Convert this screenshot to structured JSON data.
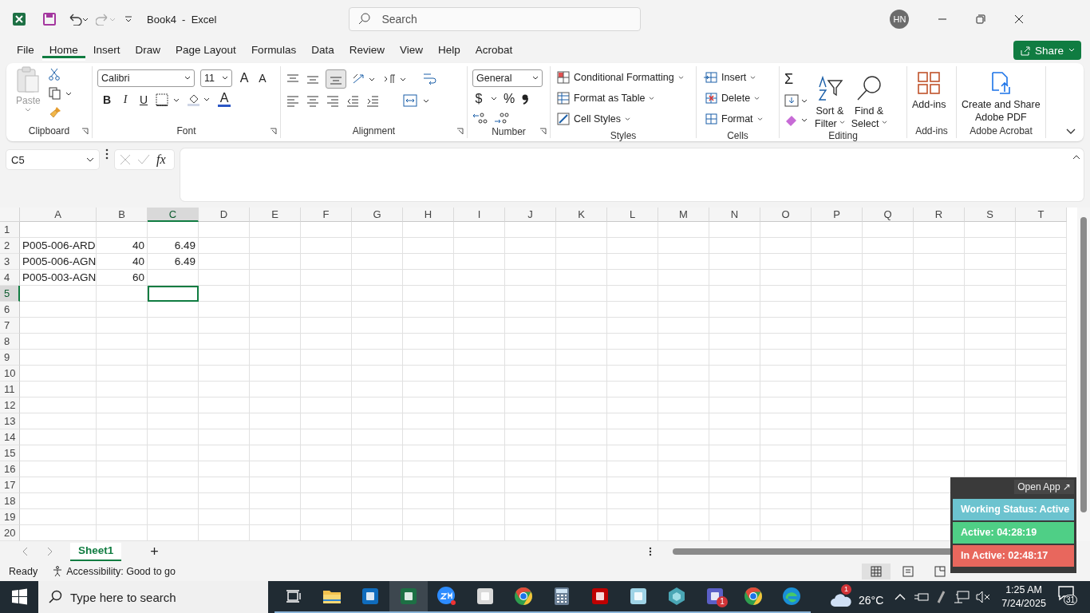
{
  "title_bar": {
    "title": "Book4  -  Excel",
    "search": {
      "placeholder": "Search"
    },
    "avatar": "HN"
  },
  "tabs": [
    {
      "label": "File",
      "selected": false
    },
    {
      "label": "Home",
      "selected": true
    },
    {
      "label": "Insert",
      "selected": false
    },
    {
      "label": "Draw",
      "selected": false
    },
    {
      "label": "Page Layout",
      "selected": false
    },
    {
      "label": "Formulas",
      "selected": false
    },
    {
      "label": "Data",
      "selected": false
    },
    {
      "label": "Review",
      "selected": false
    },
    {
      "label": "View",
      "selected": false
    },
    {
      "label": "Help",
      "selected": false
    },
    {
      "label": "Acrobat",
      "selected": false
    }
  ],
  "share_button": "Share",
  "ribbon": {
    "clipboard": {
      "paste": "Paste",
      "label": "Clipboard"
    },
    "font": {
      "name": "Calibri",
      "size": "11",
      "grow": "A",
      "shrink": "A",
      "bold": "B",
      "italic": "I",
      "underline": "U",
      "color_letter": "A",
      "label": "Font"
    },
    "alignment": {
      "label": "Alignment"
    },
    "number": {
      "format": "General",
      "currency": "$",
      "percent": "%",
      "label": "Number"
    },
    "styles": {
      "items": [
        "Conditional Formatting",
        "Format as Table",
        "Cell Styles"
      ],
      "label": "Styles"
    },
    "cells": {
      "items": [
        "Insert",
        "Delete",
        "Format"
      ],
      "label": "Cells"
    },
    "editing": {
      "sum": "Σ",
      "sort": [
        "Sort &",
        "Filter"
      ],
      "find": [
        "Find &",
        "Select"
      ],
      "label": "Editing"
    },
    "addins": {
      "button": "Add-ins",
      "label": "Add-ins"
    },
    "acrobat": {
      "button": [
        "Create and Share",
        "Adobe PDF"
      ],
      "label": "Adobe Acrobat"
    }
  },
  "formula_bar": {
    "name_box": "C5",
    "function_label": "fx"
  },
  "sheet": {
    "columns": [
      {
        "label": "A",
        "selected": false
      },
      {
        "label": "B",
        "selected": false
      },
      {
        "label": "C",
        "selected": true
      },
      {
        "label": "D",
        "selected": false
      },
      {
        "label": "E",
        "selected": false
      },
      {
        "label": "F",
        "selected": false
      },
      {
        "label": "G",
        "selected": false
      },
      {
        "label": "H",
        "selected": false
      },
      {
        "label": "I",
        "selected": false
      },
      {
        "label": "J",
        "selected": false
      },
      {
        "label": "K",
        "selected": false
      },
      {
        "label": "L",
        "selected": false
      },
      {
        "label": "M",
        "selected": false
      },
      {
        "label": "N",
        "selected": false
      },
      {
        "label": "O",
        "selected": false
      },
      {
        "label": "P",
        "selected": false
      },
      {
        "label": "Q",
        "selected": false
      },
      {
        "label": "R",
        "selected": false
      },
      {
        "label": "S",
        "selected": false
      },
      {
        "label": "T",
        "selected": false
      }
    ],
    "rows": [
      {
        "number": "1",
        "selected": false,
        "cells": {}
      },
      {
        "number": "2",
        "selected": false,
        "cells": {
          "A": "P005-006-ARD",
          "B": "40",
          "C": "6.49"
        }
      },
      {
        "number": "3",
        "selected": false,
        "cells": {
          "A": "P005-006-AGN",
          "B": "40",
          "C": "6.49"
        }
      },
      {
        "number": "4",
        "selected": false,
        "cells": {
          "A": "P005-003-AGN",
          "B": "60"
        }
      },
      {
        "number": "5",
        "selected": true,
        "cells": {}
      },
      {
        "number": "6",
        "selected": false,
        "cells": {}
      },
      {
        "number": "7",
        "selected": false,
        "cells": {}
      },
      {
        "number": "8",
        "selected": false,
        "cells": {}
      },
      {
        "number": "9",
        "selected": false,
        "cells": {}
      },
      {
        "number": "10",
        "selected": false,
        "cells": {}
      },
      {
        "number": "11",
        "selected": false,
        "cells": {}
      },
      {
        "number": "12",
        "selected": false,
        "cells": {}
      },
      {
        "number": "13",
        "selected": false,
        "cells": {}
      },
      {
        "number": "14",
        "selected": false,
        "cells": {}
      },
      {
        "number": "15",
        "selected": false,
        "cells": {}
      },
      {
        "number": "16",
        "selected": false,
        "cells": {}
      },
      {
        "number": "17",
        "selected": false,
        "cells": {}
      },
      {
        "number": "18",
        "selected": false,
        "cells": {}
      },
      {
        "number": "19",
        "selected": false,
        "cells": {}
      },
      {
        "number": "20",
        "selected": false,
        "cells": {}
      }
    ]
  },
  "sheet_tabs": [
    {
      "label": "Sheet1",
      "selected": true
    }
  ],
  "add_sheet": "+",
  "status_bar": {
    "mode": "Ready",
    "accessibility": "Accessibility: Good to go"
  },
  "tracker": {
    "open_app": "Open App ↗",
    "rows": [
      {
        "text": "Working Status: Active",
        "color": "#6cc3cf"
      },
      {
        "text": "Active: 04:28:19",
        "color": "#4fcf86"
      },
      {
        "text": "In Active: 02:48:17",
        "color": "#e8675d"
      }
    ]
  },
  "taskbar": {
    "search": {
      "placeholder": "Type here to search"
    },
    "apps": [
      {
        "kind": "taskview",
        "selected": false
      },
      {
        "kind": "folder",
        "selected": false
      },
      {
        "kind": "outlook",
        "selected": false
      },
      {
        "kind": "excel",
        "selected": true
      },
      {
        "kind": "zoom",
        "selected": false
      },
      {
        "kind": "satellite",
        "selected": false
      },
      {
        "kind": "chrome",
        "selected": false
      },
      {
        "kind": "calculator",
        "selected": false
      },
      {
        "kind": "filezilla",
        "selected": false
      },
      {
        "kind": "notepad",
        "selected": false
      },
      {
        "kind": "hexagon",
        "selected": false
      },
      {
        "kind": "teams",
        "selected": false,
        "badge": "1"
      },
      {
        "kind": "chrome",
        "selected": false
      },
      {
        "kind": "edge",
        "selected": false
      }
    ],
    "weather": {
      "badge": "1",
      "temperature": "26°C"
    },
    "time": "1:25 AM",
    "date": "7/24/2025",
    "notifications": "31"
  }
}
